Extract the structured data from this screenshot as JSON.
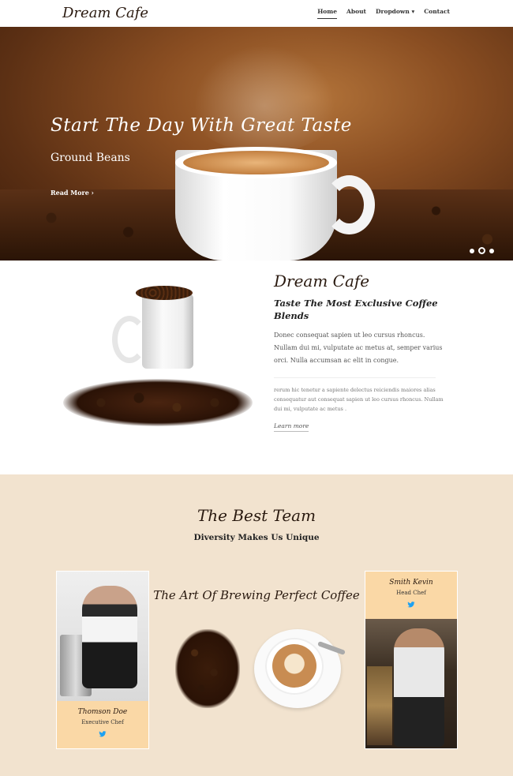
{
  "nav": {
    "brand": "Dream Cafe",
    "items": [
      "Home",
      "About",
      "Dropdown ▾",
      "Contact"
    ]
  },
  "hero": {
    "title": "Start The Day With Great Taste",
    "subtitle": "Ground Beans",
    "cta": "Read More ›",
    "slides": 3,
    "active_slide": 2
  },
  "about": {
    "brand": "Dream Cafe",
    "heading": "Taste The Most Exclusive Coffee Blends",
    "paragraph": "Donec consequat sapien ut leo cursus rhoncus. Nullam dui mi, vulputate ac metus at, semper varius orci. Nulla accumsan ac elit in congue.",
    "paragraph2": "rerum hic tenetur a sapiente delectus reiciendis maiores alias consequatur aut consequat sapien ut leo cursus rhoncus. Nullam dui mi, vulputate ac metus .",
    "link": "Learn more"
  },
  "team": {
    "title": "The Best Team",
    "subtitle": "Diversity Makes Us Unique",
    "center_title": "The Art Of Brewing Perfect Coffee",
    "members": [
      {
        "name": "Thomson Doe",
        "role": "Executive Chef"
      },
      {
        "name": "Smith Kevin",
        "role": "Head Chef"
      }
    ]
  },
  "colors": {
    "team_bg": "#f2e3cf",
    "card_info_bg": "#fad8a6",
    "twitter": "#1da1f2"
  }
}
